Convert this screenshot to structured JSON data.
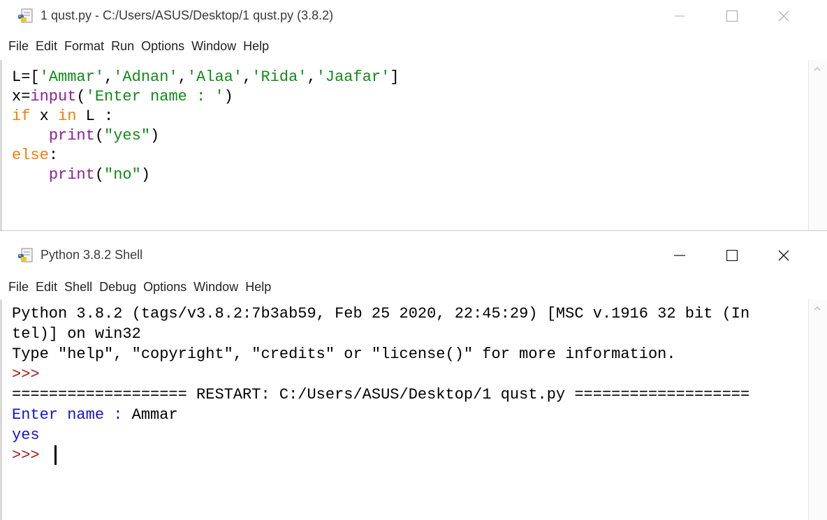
{
  "colors": {
    "default": "#000000",
    "string": "#118a18",
    "keyword": "#ef7f0a",
    "builtin": "#8a1d9b",
    "prompt": "#b31717",
    "console": "#1414c8"
  },
  "editor": {
    "title": "1 qust.py - C:/Users/ASUS/Desktop/1 qust.py (3.8.2)",
    "menu": [
      "File",
      "Edit",
      "Format",
      "Run",
      "Options",
      "Window",
      "Help"
    ],
    "code": [
      [
        {
          "t": "L=[",
          "c": "default"
        },
        {
          "t": "'Ammar'",
          "c": "string"
        },
        {
          "t": ",",
          "c": "default"
        },
        {
          "t": "'Adnan'",
          "c": "string"
        },
        {
          "t": ",",
          "c": "default"
        },
        {
          "t": "'Alaa'",
          "c": "string"
        },
        {
          "t": ",",
          "c": "default"
        },
        {
          "t": "'Rida'",
          "c": "string"
        },
        {
          "t": ",",
          "c": "default"
        },
        {
          "t": "'Jaafar'",
          "c": "string"
        },
        {
          "t": "]",
          "c": "default"
        }
      ],
      [
        {
          "t": "x=",
          "c": "default"
        },
        {
          "t": "input",
          "c": "builtin"
        },
        {
          "t": "(",
          "c": "default"
        },
        {
          "t": "'Enter name : '",
          "c": "string"
        },
        {
          "t": ")",
          "c": "default"
        }
      ],
      [
        {
          "t": "if",
          "c": "keyword"
        },
        {
          "t": " x ",
          "c": "default"
        },
        {
          "t": "in",
          "c": "keyword"
        },
        {
          "t": " L :",
          "c": "default"
        }
      ],
      [
        {
          "t": "    ",
          "c": "default"
        },
        {
          "t": "print",
          "c": "builtin"
        },
        {
          "t": "(",
          "c": "default"
        },
        {
          "t": "\"yes\"",
          "c": "string"
        },
        {
          "t": ")",
          "c": "default"
        }
      ],
      [
        {
          "t": "else",
          "c": "keyword"
        },
        {
          "t": ":",
          "c": "default"
        }
      ],
      [
        {
          "t": "    ",
          "c": "default"
        },
        {
          "t": "print",
          "c": "builtin"
        },
        {
          "t": "(",
          "c": "default"
        },
        {
          "t": "\"no\"",
          "c": "string"
        },
        {
          "t": ")",
          "c": "default"
        }
      ]
    ]
  },
  "shell": {
    "title": "Python 3.8.2 Shell",
    "menu": [
      "File",
      "Edit",
      "Shell",
      "Debug",
      "Options",
      "Window",
      "Help"
    ],
    "lines": [
      [
        {
          "t": "Python 3.8.2 (tags/v3.8.2:7b3ab59, Feb 25 2020, 22:45:29) [MSC v.1916 32 bit (In",
          "c": "default"
        }
      ],
      [
        {
          "t": "tel)] on win32",
          "c": "default"
        }
      ],
      [
        {
          "t": "Type \"help\", \"copyright\", \"credits\" or \"license()\" for more information.",
          "c": "default"
        }
      ],
      [
        {
          "t": ">>>",
          "c": "prompt"
        }
      ],
      [
        {
          "t": "=================== RESTART: C:/Users/ASUS/Desktop/1 qust.py ===================",
          "c": "default"
        }
      ],
      [
        {
          "t": "Enter name : ",
          "c": "console"
        },
        {
          "t": "Ammar",
          "c": "default"
        }
      ],
      [
        {
          "t": "yes",
          "c": "console"
        }
      ],
      [
        {
          "t": ">>> ",
          "c": "prompt"
        }
      ]
    ]
  }
}
